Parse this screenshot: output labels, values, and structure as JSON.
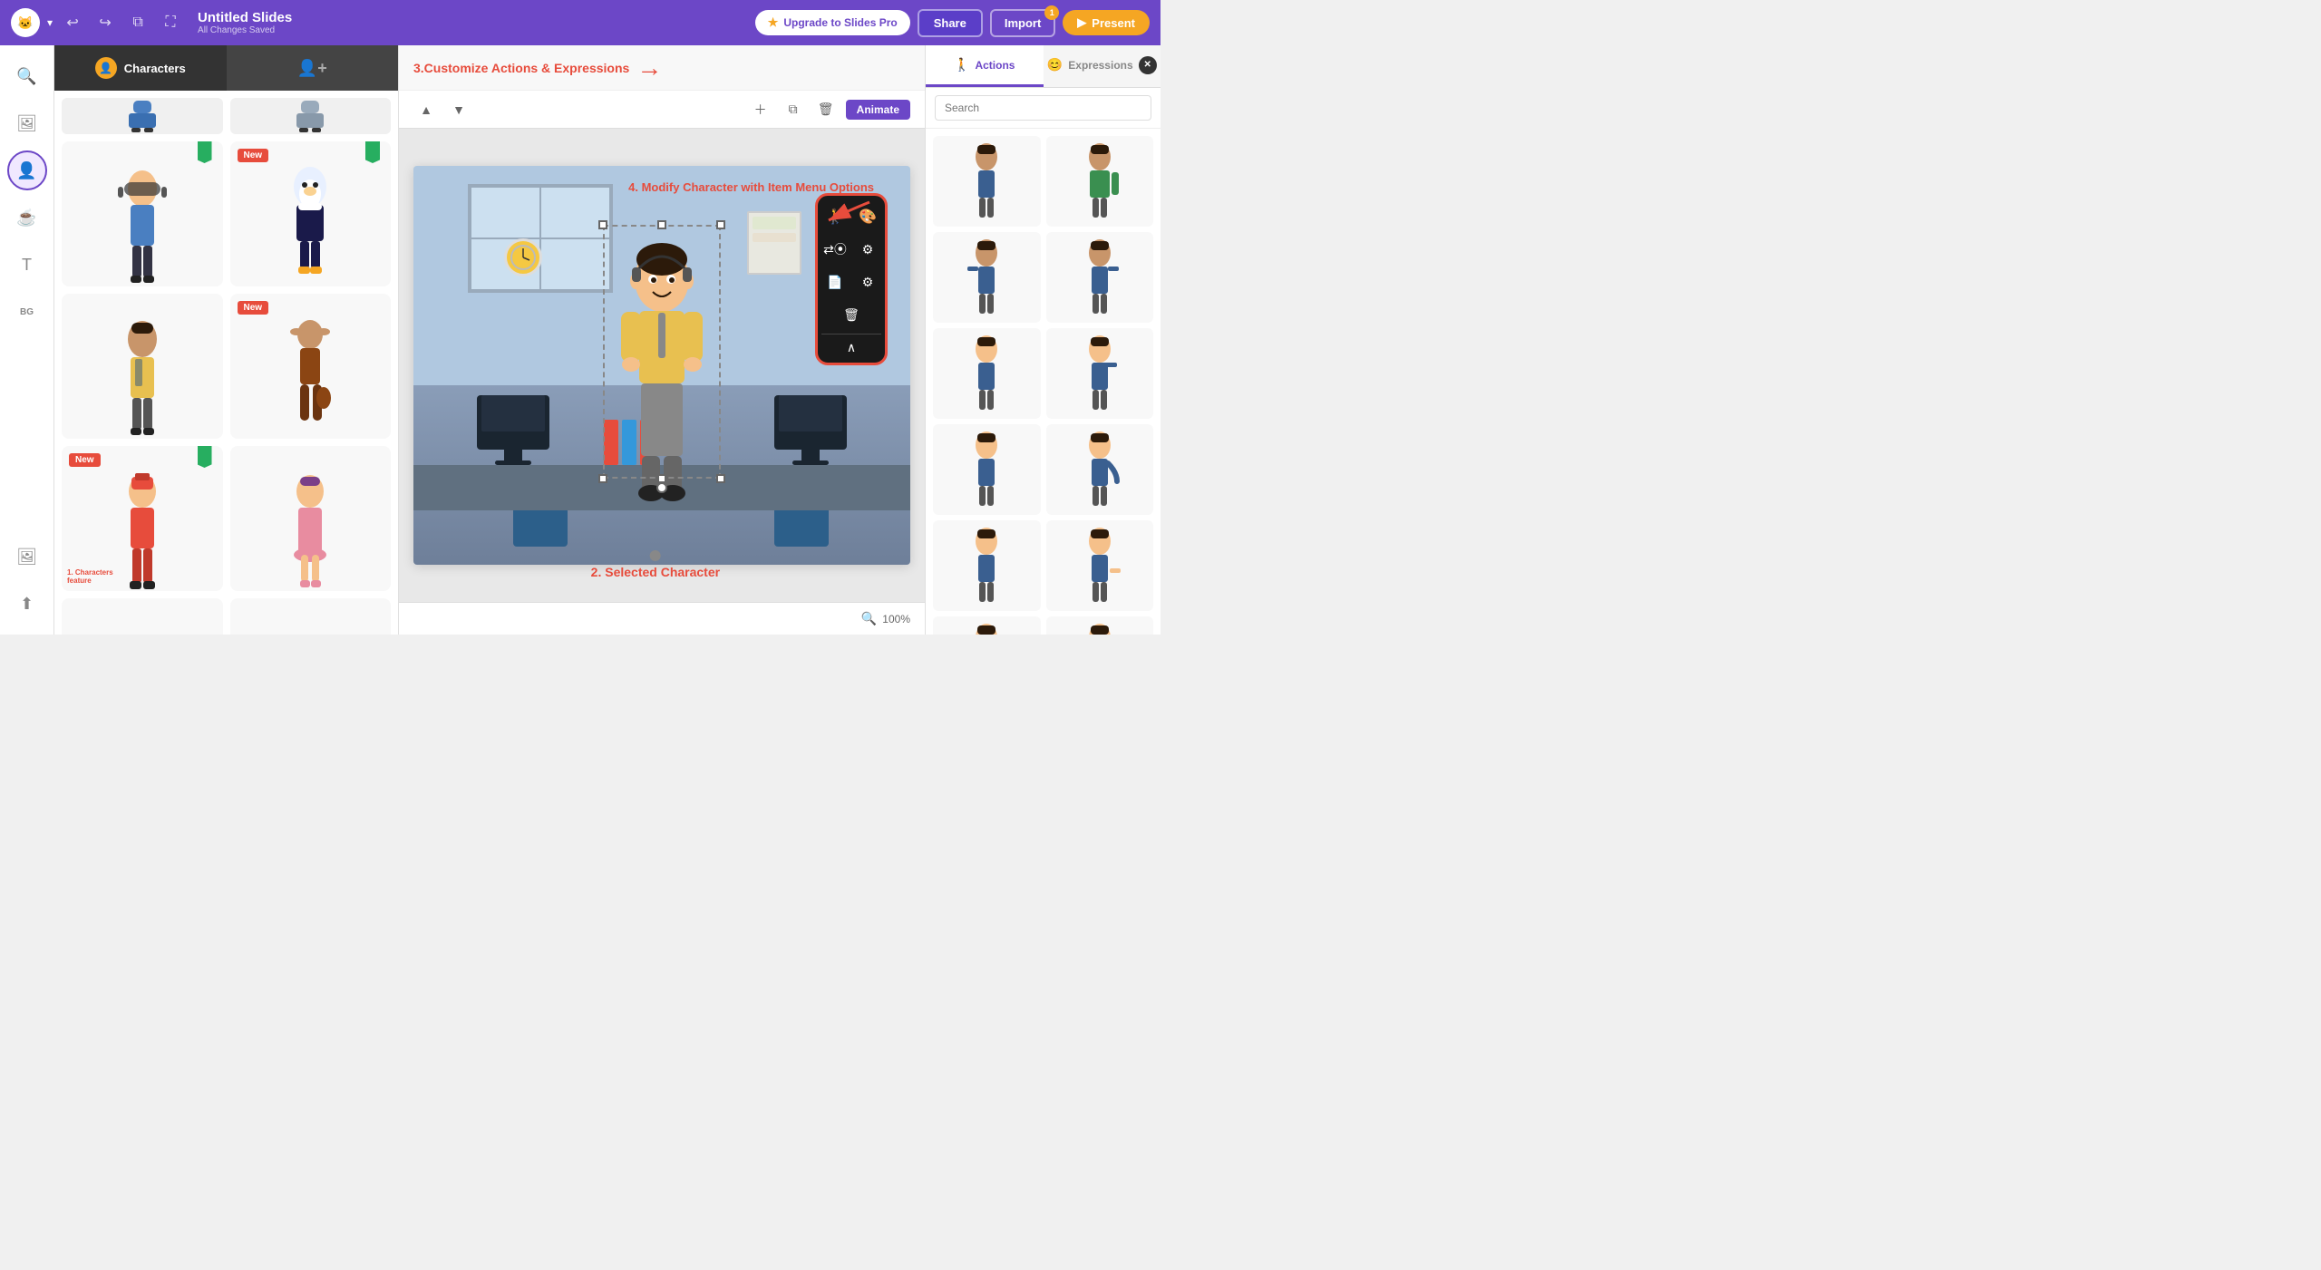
{
  "app": {
    "logo": "🐱",
    "title": "Untitled Slides",
    "subtitle": "All Changes Saved"
  },
  "topbar": {
    "upgrade_label": "Upgrade to Slides Pro",
    "share_label": "Share",
    "import_label": "Import",
    "import_badge": "1",
    "present_label": "▶ Present",
    "undo_icon": "↩",
    "redo_icon": "↪",
    "duplicate_icon": "⧉",
    "fullscreen_icon": "⛶"
  },
  "character_panel": {
    "tab1_label": "Characters",
    "tab2_label": "",
    "step1_label": "1. Characters\nfeature"
  },
  "slide": {
    "animate_label": "Animate",
    "zoom_label": "100%",
    "selected_character_label": "2. Selected Character",
    "step3_label": "3.Customize Actions & Expressions",
    "step4_label": "4. Modify Character with Item Menu Options"
  },
  "right_panel": {
    "tab_actions": "Actions",
    "tab_expressions": "Expressions",
    "search_placeholder": "Search"
  },
  "characters": [
    {
      "id": 1,
      "label": "",
      "has_new": false,
      "has_bookmark": true,
      "shirt_color": "#4a7fc1",
      "shirt_type": "uniform"
    },
    {
      "id": 2,
      "label": "New",
      "has_new": true,
      "has_bookmark": true,
      "shirt_color": "#e8f0ff",
      "type": "penguin"
    },
    {
      "id": 3,
      "label": "",
      "has_new": false,
      "has_bookmark": false,
      "shirt_color": "#e8c050"
    },
    {
      "id": 4,
      "label": "New",
      "has_new": true,
      "has_bookmark": false,
      "shirt_color": "#8b4513",
      "type": "kangaroo"
    },
    {
      "id": 5,
      "label": "1. Characters feature",
      "has_new": true,
      "has_bookmark": true,
      "shirt_color": "#e74c3c",
      "type": "firefighter"
    },
    {
      "id": 6,
      "label": "",
      "has_new": false,
      "has_bookmark": false,
      "shirt_color": "#e88ca0",
      "type": "female"
    },
    {
      "id": 7,
      "label": "",
      "has_new": false,
      "has_bookmark": false,
      "shirt_color": "#555"
    },
    {
      "id": 8,
      "label": "",
      "has_new": false,
      "has_bookmark": false,
      "shirt_color": "#6c47c7"
    }
  ]
}
